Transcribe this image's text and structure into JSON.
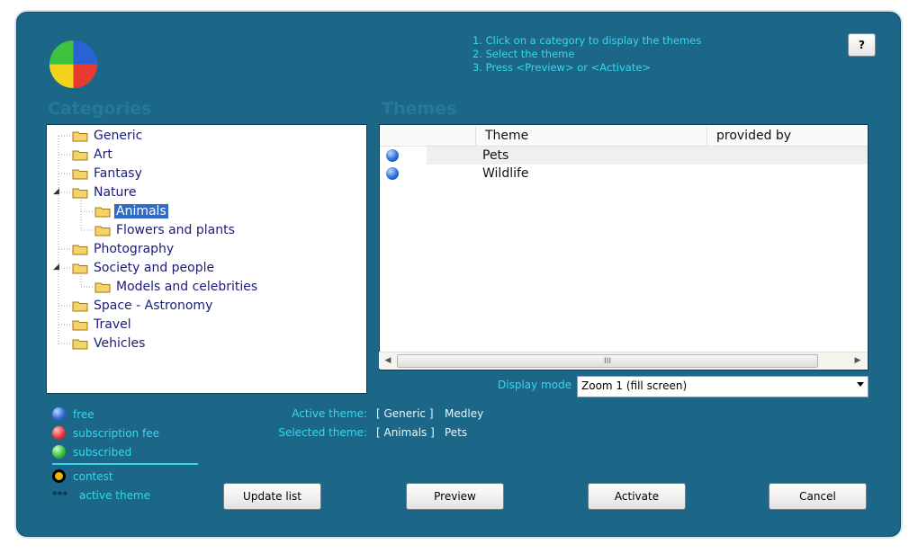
{
  "instructions": [
    "1. Click on a category to display the themes",
    "2. Select the theme",
    "3. Press <Preview> or <Activate>"
  ],
  "help_label": "?",
  "categories_title": "Categories",
  "themes_title": "Themes",
  "categories": [
    {
      "label": "Generic"
    },
    {
      "label": "Art"
    },
    {
      "label": "Fantasy"
    },
    {
      "label": "Nature",
      "expander": "◢"
    },
    {
      "label": "Animals",
      "selected": true
    },
    {
      "label": "Flowers and plants"
    },
    {
      "label": "Photography"
    },
    {
      "label": "Society and people",
      "expander": "◢"
    },
    {
      "label": "Models and celebrities"
    },
    {
      "label": "Space - Astronomy"
    },
    {
      "label": "Travel"
    },
    {
      "label": "Vehicles"
    }
  ],
  "grid": {
    "columns": [
      "Theme",
      "provided by"
    ],
    "rows": [
      {
        "theme": "Pets",
        "provided_by": "",
        "status": "free"
      },
      {
        "theme": "Wildlife",
        "provided_by": "",
        "status": "free"
      }
    ],
    "scroll_grip": "III"
  },
  "display_mode": {
    "label": "Display mode",
    "value": "Zoom 1 (fill screen)"
  },
  "legend": {
    "free": "free",
    "subscription_fee": "subscription fee",
    "subscribed": "subscribed",
    "contest": "contest",
    "active_marker": "***",
    "active_theme": "active theme"
  },
  "info": {
    "active_label": "Active theme:",
    "active_category": "[ Generic ]",
    "active_theme": "Medley",
    "selected_label": "Selected theme:",
    "selected_category": "[ Animals ]",
    "selected_theme": "Pets"
  },
  "buttons": {
    "update": "Update list",
    "preview": "Preview",
    "activate": "Activate",
    "cancel": "Cancel"
  },
  "colors": {
    "window_bg": "#1c6787",
    "accent_text": "#36d7ee",
    "free": "#3a7be0",
    "subscription_fee": "#e23b3b",
    "subscribed": "#3cc23c",
    "contest": "#f0b400"
  },
  "icons": {
    "logo": "four-color-circle-icon",
    "folder": "folder-icon",
    "status": "ball-icon"
  }
}
